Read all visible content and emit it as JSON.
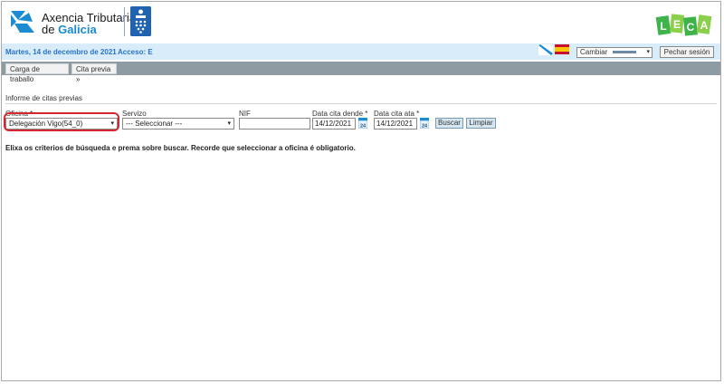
{
  "header": {
    "logo_line1": "Axencia Tributaria",
    "logo_line2_prefix": "de ",
    "logo_line2_bold": "Galicia",
    "leca_letters": [
      "L",
      "E",
      "C",
      "A"
    ]
  },
  "infobar": {
    "date": "Martes, 14 de decembro de 2021",
    "acceso": "Acceso: E",
    "language_select": "Cambiar",
    "logout_label": "Pechar sesión"
  },
  "tabs": [
    {
      "label": "Carga de traballo"
    },
    {
      "label": "Cita previa »"
    }
  ],
  "form": {
    "section_title": "Informe de citas previas",
    "oficina_label": "Oficina *",
    "oficina_value": "Delegación Vigo(54_0)",
    "servizo_label": "Servizo",
    "servizo_value": "--- Seleccionar ---",
    "nif_label": "NIF",
    "nif_value": "",
    "data_dende_label": "Data cita dende *",
    "data_dende_value": "14/12/2021",
    "data_ata_label": "Data cita ata *",
    "data_ata_value": "14/12/2021",
    "calendar_day": "24",
    "buscar_label": "Buscar",
    "limpiar_label": "Limpiar"
  },
  "message": "Elixa os criterios de búsqueda e prema sobre buscar. Recorde que seleccionar a oficina é obligatorio.",
  "colors": {
    "infobar_bg": "#d9ecf9",
    "tabbar_bg": "#8f9ba3",
    "highlight": "#d6262f",
    "brand_blue": "#1b8bd3"
  }
}
